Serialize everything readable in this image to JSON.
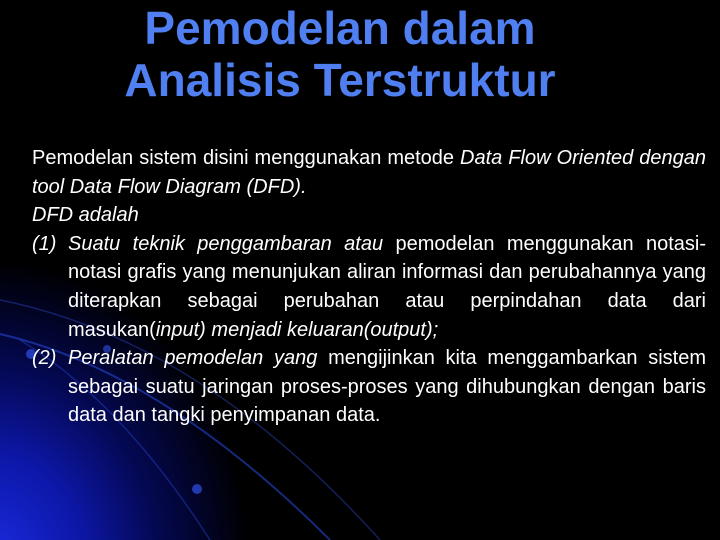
{
  "slide": {
    "title_lines": [
      "Pemodelan dalam",
      "Analisis Terstruktur"
    ],
    "colors": {
      "background": "#000000",
      "title": "#4f7ff0",
      "body_text": "#ffffff",
      "accent_glow": "#1a2be0"
    },
    "intro": {
      "segments": [
        {
          "text": "Pemodelan sistem disini menggunakan metode ",
          "italic": false
        },
        {
          "text": "Data Flow Oriented dengan tool Data Flow Diagram (DFD).",
          "italic": true
        }
      ]
    },
    "dfd_label": "DFD adalah",
    "items": [
      {
        "number": "(1)",
        "segments": [
          {
            "text": "Suatu teknik penggambaran atau",
            "italic": true
          },
          {
            "text": " pemodelan menggunakan notasi-notasi grafis yang menunjukan aliran informasi dan perubahannya yang diterapkan sebagai perubahan atau perpindahan data dari masukan(",
            "italic": false
          },
          {
            "text": "input)",
            "italic": true
          },
          {
            "text": " ",
            "italic": false
          },
          {
            "text": "menjadi keluaran(output);",
            "italic": true
          }
        ]
      },
      {
        "number": "(2)",
        "segments": [
          {
            "text": "Peralatan pemodelan yang",
            "italic": true
          },
          {
            "text": " mengijinkan kita menggambarkan sistem sebagai suatu jaringan proses-proses yang dihubungkan dengan baris data dan tangki penyimpanan data.",
            "italic": false
          }
        ]
      }
    ]
  }
}
